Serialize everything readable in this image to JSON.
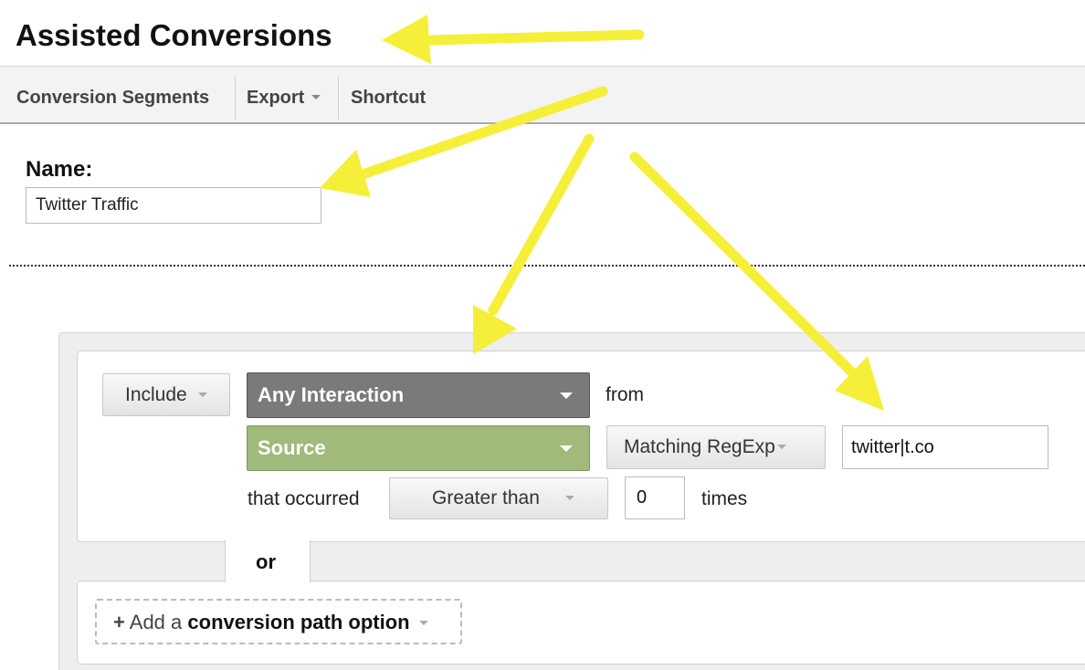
{
  "header": {
    "title": "Assisted Conversions"
  },
  "toolbar": {
    "conversion_segments": "Conversion Segments",
    "export": "Export",
    "shortcut": "Shortcut"
  },
  "name_field": {
    "label": "Name:",
    "value": "Twitter Traffic"
  },
  "condition": {
    "include": "Include",
    "interaction": "Any Interaction",
    "from": "from",
    "dimension": "Source",
    "match_type": "Matching RegExp",
    "match_value": "twitter|t.co",
    "occurred_label": "that occurred",
    "comparison": "Greater than",
    "count": "0",
    "times_label": "times"
  },
  "or_label": "or",
  "add_option": {
    "plus": "+",
    "prefix": "Add a",
    "bold_text": "conversion path option"
  },
  "colors": {
    "arrow": "#f5ef3a",
    "interaction_bg": "#7a7a7a",
    "source_bg": "#9fba7a"
  }
}
